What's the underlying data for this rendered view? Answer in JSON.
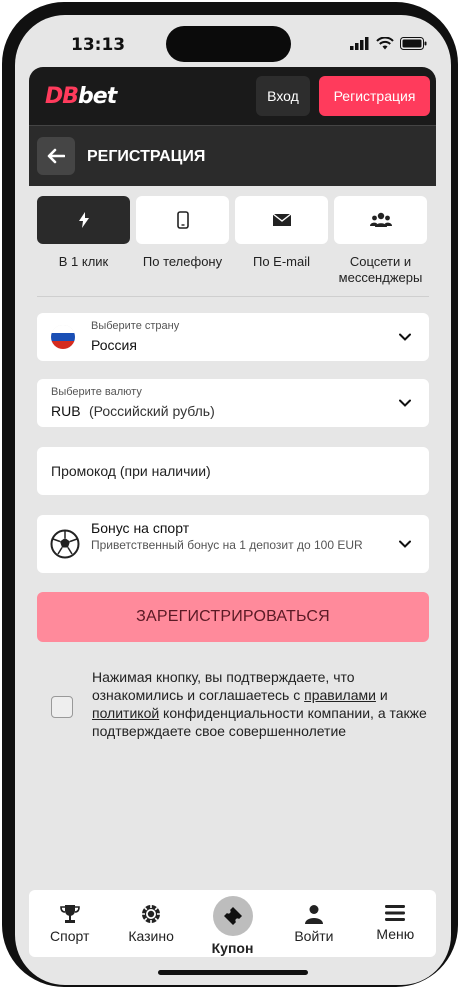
{
  "status_bar": {
    "time": "13:13"
  },
  "header": {
    "logo_prefix": "DB",
    "logo_suffix": "bet",
    "login_label": "Вход",
    "register_label": "Регистрация"
  },
  "subheader": {
    "title": "РЕГИСТРАЦИЯ"
  },
  "tabs": [
    {
      "label": "В 1 клик",
      "icon": "lightning-icon",
      "active": true
    },
    {
      "label": "По телефону",
      "icon": "phone-icon",
      "active": false
    },
    {
      "label": "По E-mail",
      "icon": "envelope-icon",
      "active": false
    },
    {
      "label": "Соцсети и мессенджеры",
      "icon": "users-icon",
      "active": false
    }
  ],
  "form": {
    "country": {
      "label": "Выберите страну",
      "value": "Россия"
    },
    "currency": {
      "label": "Выберите валюту",
      "code": "RUB",
      "name": "(Российский рубль)"
    },
    "promo": {
      "placeholder": "Промокод (при наличии)"
    },
    "bonus": {
      "title": "Бонус на спорт",
      "description": "Приветственный бонус на 1 депозит до 100 EUR"
    },
    "submit_label": "ЗАРЕГИСТРИРОВАТЬСЯ",
    "agreement": {
      "part1": "Нажимая кнопку, вы подтверждаете, что ознакомились и соглашаетесь с ",
      "link_rules": "правилами",
      "part2": " и ",
      "link_policy": "политикой",
      "part3": " конфиденциальности компании, а также подтверждаете свое совершеннолетие"
    }
  },
  "bottom_nav": [
    {
      "label": "Спорт",
      "icon": "trophy-icon"
    },
    {
      "label": "Казино",
      "icon": "chip-icon"
    },
    {
      "label": "Купон",
      "icon": "ticket-icon"
    },
    {
      "label": "Войти",
      "icon": "user-icon"
    },
    {
      "label": "Меню",
      "icon": "menu-icon"
    }
  ],
  "colors": {
    "brand": "#ff3b5c",
    "submit_bg": "#ff8a9b",
    "topbar": "#1a1a1a"
  }
}
